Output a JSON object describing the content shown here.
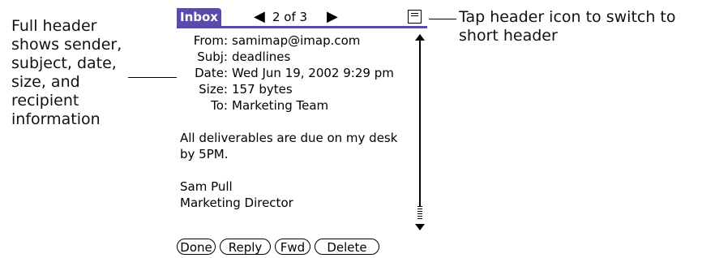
{
  "callouts": {
    "left": [
      "Full header",
      "shows sender,",
      "subject, date,",
      "size, and",
      "recipient",
      "information"
    ],
    "right": [
      "Tap header icon to switch to",
      "short header"
    ]
  },
  "app": {
    "title": "Inbox",
    "message_position": "2 of 3",
    "prev_icon": "left-triangle-icon",
    "next_icon": "right-triangle-icon",
    "header_toggle_icon": "header-icon"
  },
  "message": {
    "headers": [
      {
        "label": "From:",
        "value": "samimap@imap.com"
      },
      {
        "label": "Subj:",
        "value": "deadlines"
      },
      {
        "label": "Date:",
        "value": "Wed Jun 19, 2002 9:29 pm"
      },
      {
        "label": "Size:",
        "value": "157 bytes"
      },
      {
        "label": "To:",
        "value": "Marketing Team"
      }
    ],
    "body": [
      "All deliverables are due on my desk",
      "by 5PM."
    ],
    "signature": [
      "Sam Pull",
      "Marketing Director"
    ]
  },
  "buttons": {
    "done": "Done",
    "reply": "Reply",
    "fwd": "Fwd",
    "delete": "Delete"
  },
  "colors": {
    "title_bar": "#5b4aa8"
  }
}
